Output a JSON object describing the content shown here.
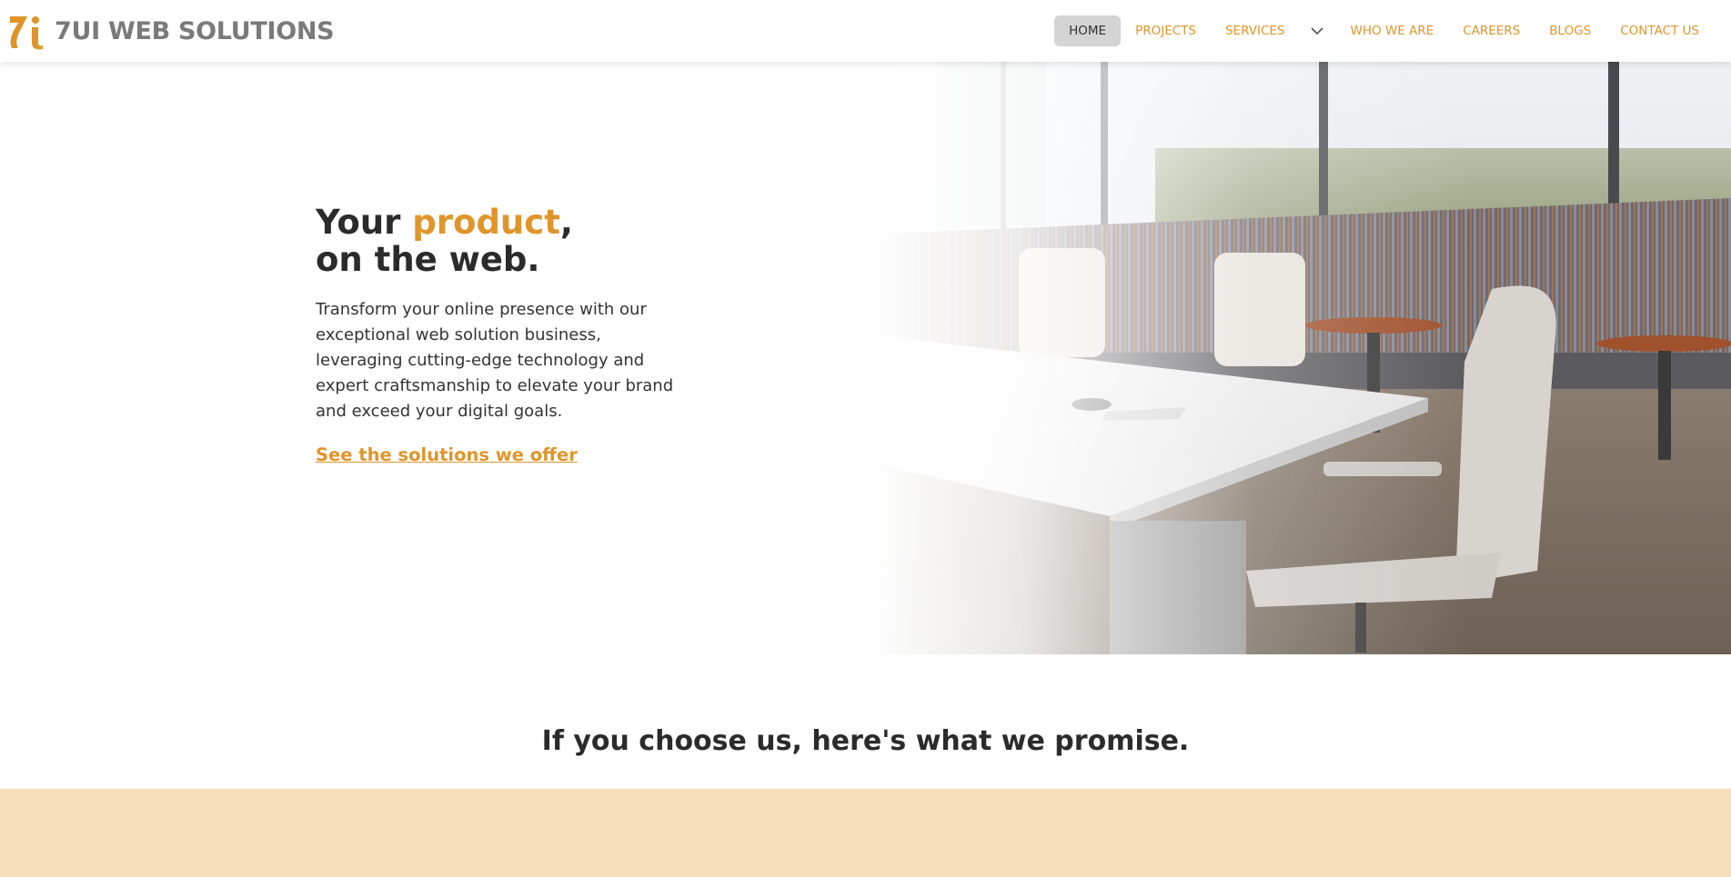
{
  "brand": {
    "name": "7UI WEB SOLUTIONS",
    "logo_icon": "7i-logo",
    "accent_color": "#e0952a"
  },
  "nav": {
    "items": [
      {
        "label": "HOME",
        "active": true
      },
      {
        "label": "PROJECTS",
        "active": false
      },
      {
        "label": "SERVICES",
        "active": false
      },
      {
        "label": "WHO WE ARE",
        "active": false
      },
      {
        "label": "CAREERS",
        "active": false
      },
      {
        "label": "BLOGS",
        "active": false
      },
      {
        "label": "CONTACT US",
        "active": false
      }
    ],
    "services_dropdown_icon": "chevron-down-icon"
  },
  "hero": {
    "title_before": "Your ",
    "title_accent": "product",
    "title_after": ",",
    "title_line2": "on the web.",
    "description": "Transform your online presence with our exceptional web solution business, leveraging cutting-edge technology and expert craftsmanship to elevate your brand and exceed your digital goals.",
    "cta_link": "See the solutions we offer"
  },
  "promise": {
    "heading": "If you choose us, here's what we promise.",
    "band_color": "#f7dfba"
  }
}
